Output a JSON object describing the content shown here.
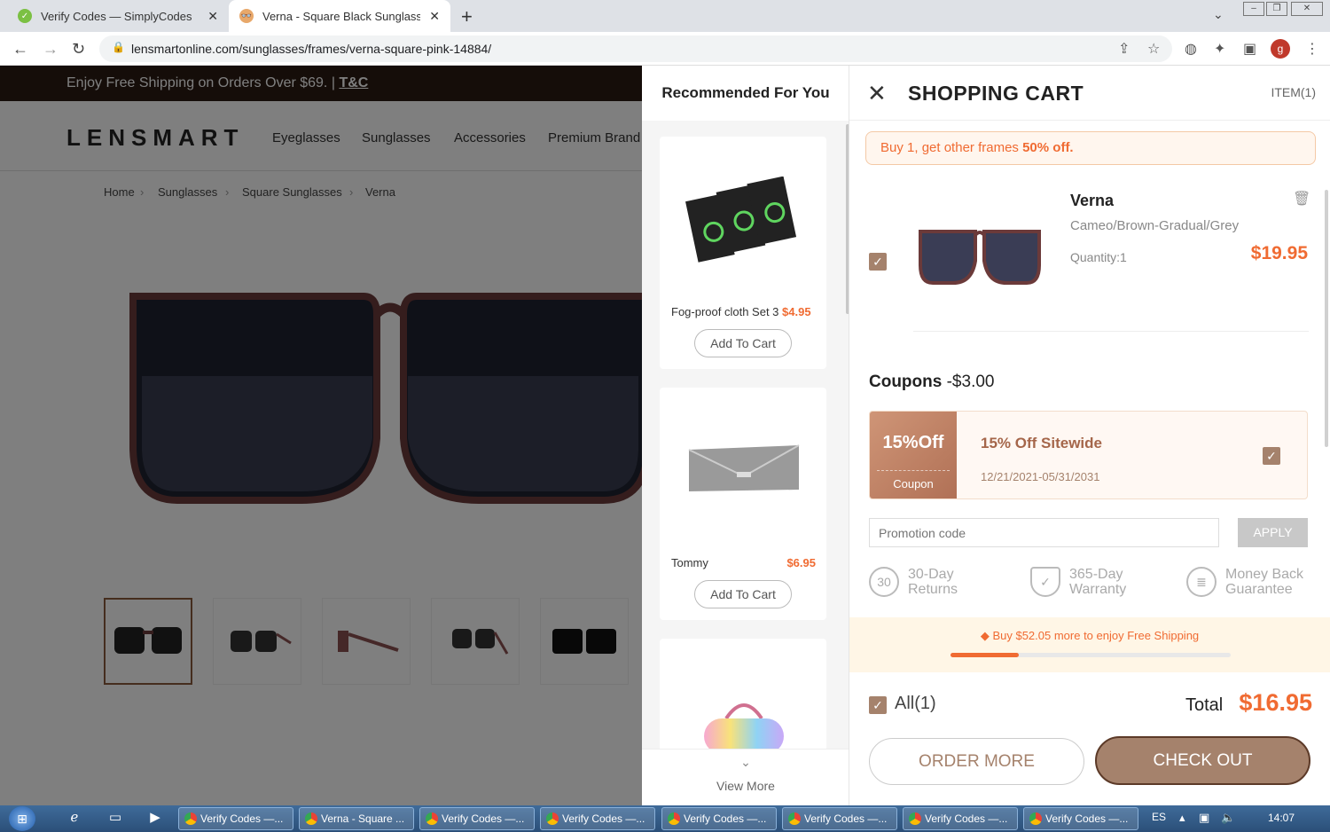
{
  "browser": {
    "tabs": [
      {
        "title": "Verify Codes — SimplyCodes",
        "favicon": "simplycodes-icon"
      },
      {
        "title": "Verna - Square Black Sunglasses",
        "favicon": "lensmart-icon"
      }
    ],
    "url": "lensmartonline.com/sunglasses/frames/verna-square-pink-14884/",
    "profile_initial": "g"
  },
  "page": {
    "promo_text": "Enjoy Free Shipping on Orders Over $69. |",
    "promo_link": "T&C",
    "logo": "LENSMART",
    "nav": [
      "Eyeglasses",
      "Sunglasses",
      "Accessories",
      "Premium Brand"
    ],
    "breadcrumb": [
      "Home",
      "Sunglasses",
      "Square Sunglasses",
      "Verna"
    ]
  },
  "recommended": {
    "title": "Recommended For You",
    "items": [
      {
        "name": "Fog-proof cloth Set 3",
        "price": "$4.95",
        "button": "Add To Cart"
      },
      {
        "name": "Tommy",
        "price": "$6.95",
        "button": "Add To Cart"
      },
      {
        "name": "",
        "price": "",
        "button": ""
      }
    ],
    "view_more": "View More"
  },
  "cart": {
    "title": "SHOPPING CART",
    "items_count": "ITEM(1)",
    "offer_prefix": "Buy 1, get other frames",
    "offer_highlight": "50% off.",
    "product": {
      "name": "Verna",
      "color": "Cameo/Brown-Gradual/Grey",
      "quantity": "Quantity:1",
      "price": "$19.95",
      "checked": true
    },
    "coupons_label": "Coupons",
    "coupons_discount": "-$3.00",
    "coupon": {
      "badge": "15%Off",
      "badge_sub": "Coupon",
      "name": "15% Off Sitewide",
      "dates": "12/21/2021-05/31/2031",
      "checked": true
    },
    "promo_placeholder": "Promotion code",
    "apply": "APPLY",
    "assurances": [
      {
        "icon": "returns-30-icon",
        "line1": "30-Day",
        "line2": "Returns"
      },
      {
        "icon": "shield-warranty-icon",
        "line1": "365-Day",
        "line2": "Warranty"
      },
      {
        "icon": "money-back-icon",
        "line1": "Money Back",
        "line2": "Guarantee"
      }
    ],
    "shipping_msg": "Buy $52.05 more to enjoy Free Shipping",
    "shipping_progress": 0.245,
    "all_label": "All(1)",
    "total_label": "Total",
    "total_value": "$16.95",
    "order_more": "ORDER MORE",
    "checkout": "CHECK OUT"
  },
  "taskbar": {
    "buttons": [
      "Verify Codes —...",
      "Verna - Square ...",
      "Verify Codes —...",
      "Verify Codes —...",
      "Verify Codes —...",
      "Verify Codes —...",
      "Verify Codes —...",
      "Verify Codes —..."
    ],
    "lang": "ES",
    "time": "14:07"
  },
  "colors": {
    "accent": "#f06b32",
    "brand_brown": "#a5826c",
    "checkout_border": "#5c3a28"
  }
}
